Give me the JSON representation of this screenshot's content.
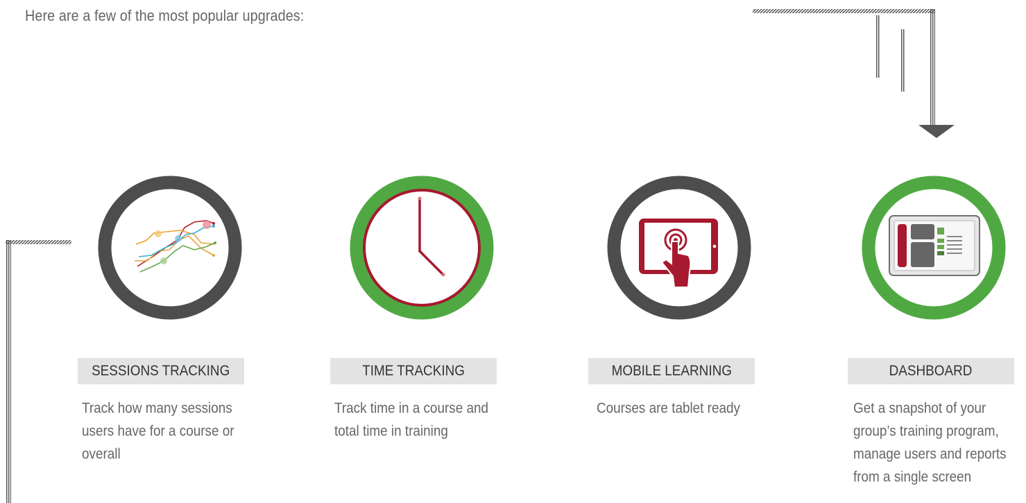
{
  "intro_text": "Here are a few of the most popular upgrades:",
  "colors": {
    "gray_ring": "#4d4d4d",
    "green_ring": "#50a843",
    "dark_red": "#a6192e",
    "title_bar_bg": "#e3e3e3",
    "text_gray": "#666666"
  },
  "features": [
    {
      "icon": "line-chart-icon",
      "ring_color": "gray",
      "title": "SESSIONS TRACKING",
      "description_lines": [
        "Track how many sessions",
        "users have for a course or",
        "overall"
      ]
    },
    {
      "icon": "clock-icon",
      "ring_color": "green",
      "title": "TIME TRACKING",
      "description_lines": [
        "Track time in a course and",
        "total time in training"
      ]
    },
    {
      "icon": "tablet-touch-icon",
      "ring_color": "gray",
      "title": "MOBILE LEARNING",
      "description_lines": [
        "Courses are tablet ready"
      ]
    },
    {
      "icon": "dashboard-icon",
      "ring_color": "green",
      "title": "DASHBOARD",
      "description_lines": [
        "Get a snapshot of your",
        "group’s training program,",
        "manage users and reports",
        "from a single screen"
      ]
    }
  ]
}
